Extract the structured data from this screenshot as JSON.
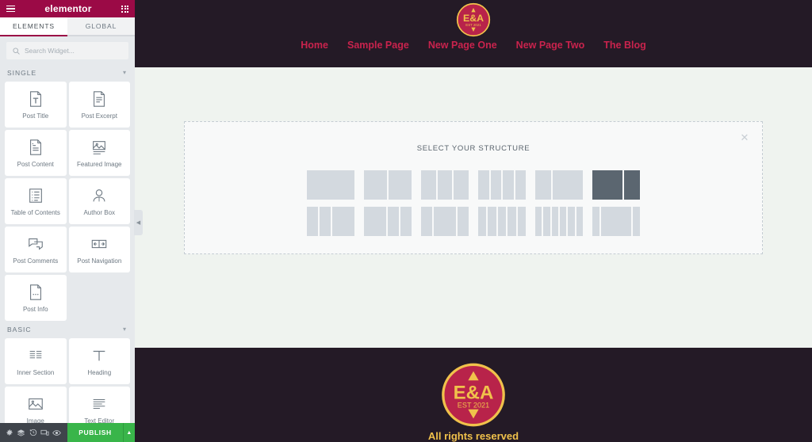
{
  "panel": {
    "brand": "elementor",
    "menu_icon": "hamburger-icon",
    "apps_icon": "grid-dots-icon",
    "tabs": [
      {
        "label": "ELEMENTS",
        "active": true
      },
      {
        "label": "GLOBAL",
        "active": false
      }
    ],
    "search": {
      "placeholder": "Search Widget...",
      "value": "",
      "icon": "search-icon"
    },
    "categories": [
      {
        "name": "SINGLE",
        "collapse_icon": "chevron-down-icon",
        "widgets": [
          {
            "label": "Post Title",
            "icon": "post-title-icon"
          },
          {
            "label": "Post Excerpt",
            "icon": "post-excerpt-icon"
          },
          {
            "label": "Post Content",
            "icon": "post-content-icon"
          },
          {
            "label": "Featured Image",
            "icon": "featured-image-icon"
          },
          {
            "label": "Table of Contents",
            "icon": "table-of-contents-icon"
          },
          {
            "label": "Author Box",
            "icon": "author-box-icon"
          },
          {
            "label": "Post Comments",
            "icon": "post-comments-icon"
          },
          {
            "label": "Post Navigation",
            "icon": "post-navigation-icon"
          },
          {
            "label": "Post Info",
            "icon": "post-info-icon"
          }
        ]
      },
      {
        "name": "BASIC",
        "collapse_icon": "chevron-down-icon",
        "widgets": [
          {
            "label": "Inner Section",
            "icon": "inner-section-icon"
          },
          {
            "label": "Heading",
            "icon": "heading-icon"
          },
          {
            "label": "Image",
            "icon": "image-icon"
          },
          {
            "label": "Text Editor",
            "icon": "text-editor-icon"
          }
        ]
      }
    ],
    "collapse_handle": "chevron-left-icon"
  },
  "bottombar": {
    "icons": [
      {
        "name": "settings-gear-icon",
        "glyph": "⚙"
      },
      {
        "name": "navigator-layers-icon",
        "glyph": "☰"
      },
      {
        "name": "history-icon",
        "glyph": "↺"
      },
      {
        "name": "responsive-mode-icon",
        "glyph": "⎕"
      },
      {
        "name": "preview-eye-icon",
        "glyph": "◉"
      }
    ],
    "publish_label": "PUBLISH",
    "publish_arrow": "▲",
    "publish_color": "#39b54a"
  },
  "preview": {
    "header": {
      "logo": {
        "name": "ea-logo",
        "initials": "E&A",
        "est": "EST 2021"
      },
      "nav": [
        {
          "label": "Home"
        },
        {
          "label": "Sample Page"
        },
        {
          "label": "New Page One"
        },
        {
          "label": "New Page Two"
        },
        {
          "label": "The Blog"
        }
      ],
      "bg_color": "#241a26",
      "link_color": "#c9234d"
    },
    "structure": {
      "title": "SELECT YOUR STRUCTURE",
      "close_icon": "close-icon",
      "close_glyph": "✕",
      "selected_index": 5,
      "presets": [
        {
          "name": "1-column",
          "cols": [
            100
          ]
        },
        {
          "name": "2-columns-equal",
          "cols": [
            50,
            50
          ]
        },
        {
          "name": "3-columns-equal",
          "cols": [
            33.3,
            33.3,
            33.3
          ]
        },
        {
          "name": "4-columns-equal",
          "cols": [
            25,
            25,
            25,
            25
          ]
        },
        {
          "name": "2-columns-33-66",
          "cols": [
            35,
            65
          ]
        },
        {
          "name": "2-columns-66-33",
          "cols": [
            65,
            35
          ]
        },
        {
          "name": "3-columns-25-25-50",
          "cols": [
            25,
            25,
            50
          ]
        },
        {
          "name": "3-columns-50-25-25",
          "cols": [
            50,
            25,
            25
          ]
        },
        {
          "name": "3-columns-25-50-25",
          "cols": [
            25,
            50,
            25
          ]
        },
        {
          "name": "5-columns-equal",
          "cols": [
            20,
            20,
            20,
            20,
            20
          ]
        },
        {
          "name": "6-columns-equal",
          "cols": [
            16.6,
            16.6,
            16.6,
            16.6,
            16.6,
            16.6
          ]
        },
        {
          "name": "3-columns-16-68-16",
          "cols": [
            16,
            68,
            16
          ]
        }
      ]
    },
    "footer": {
      "logo": {
        "name": "ea-logo",
        "initials": "E&A",
        "est": "EST 2021"
      },
      "text": "All rights reserved",
      "bg_color": "#241a26",
      "text_color": "#f0c14b"
    }
  }
}
